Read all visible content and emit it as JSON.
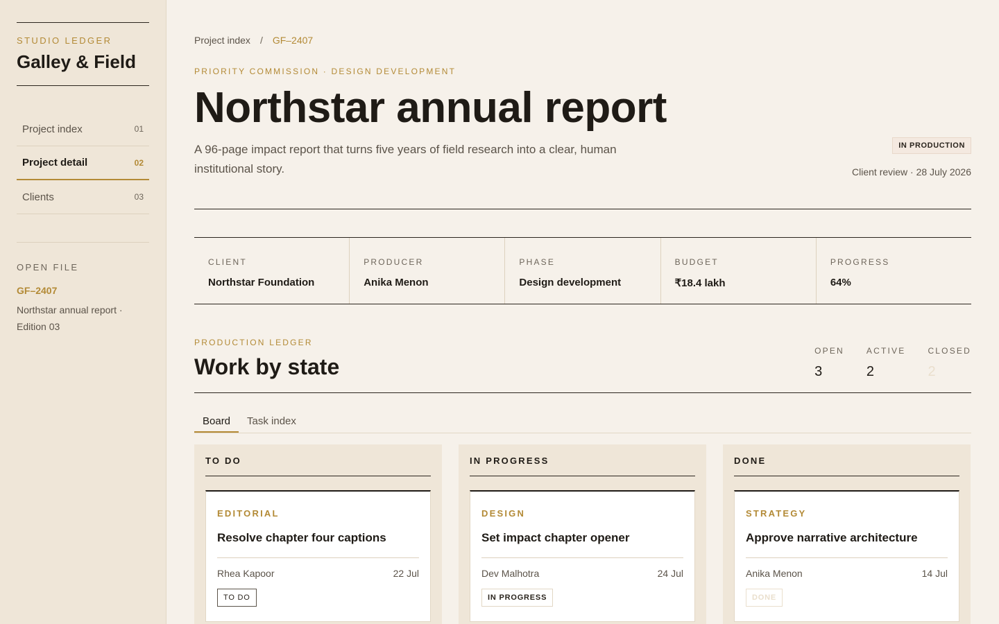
{
  "sidebar": {
    "brand_kicker": "STUDIO LEDGER",
    "brand_name": "Galley & Field",
    "nav": [
      {
        "label": "Project index",
        "num": "01"
      },
      {
        "label": "Project detail",
        "num": "02"
      },
      {
        "label": "Clients",
        "num": "03"
      }
    ],
    "open_file": {
      "kicker": "OPEN FILE",
      "id": "GF–2407",
      "desc": "Northstar annual report · Edition 03"
    }
  },
  "breadcrumb": {
    "parent": "Project index",
    "sep": "/",
    "current": "GF–2407"
  },
  "header": {
    "kicker": "PRIORITY COMMISSION · DESIGN DEVELOPMENT",
    "title": "Northstar annual report",
    "intro": "A 96-page impact report that turns five years of field research into a clear, human institutional story.",
    "status": "IN PRODUCTION",
    "review": "Client review · 28 July 2026"
  },
  "facts": [
    {
      "label": "CLIENT",
      "value": "Northstar Foundation"
    },
    {
      "label": "PRODUCER",
      "value": "Anika Menon"
    },
    {
      "label": "PHASE",
      "value": "Design development"
    },
    {
      "label": "BUDGET",
      "value": "₹18.4 lakh"
    },
    {
      "label": "PROGRESS",
      "value": "64%"
    }
  ],
  "ledger": {
    "kicker": "PRODUCTION LEDGER",
    "title": "Work by state",
    "counts": [
      {
        "label": "OPEN",
        "value": "3"
      },
      {
        "label": "ACTIVE",
        "value": "2"
      },
      {
        "label": "CLOSED",
        "value": "2"
      }
    ]
  },
  "tabs": [
    {
      "label": "Board"
    },
    {
      "label": "Task index"
    }
  ],
  "board": [
    {
      "title": "TO DO",
      "card": {
        "category": "EDITORIAL",
        "title": "Resolve chapter four captions",
        "assignee": "Rhea Kapoor",
        "date": "22 Jul",
        "status": "TO DO"
      }
    },
    {
      "title": "IN PROGRESS",
      "card": {
        "category": "DESIGN",
        "title": "Set impact chapter opener",
        "assignee": "Dev Malhotra",
        "date": "24 Jul",
        "status": "IN PROGRESS"
      }
    },
    {
      "title": "DONE",
      "card": {
        "category": "STRATEGY",
        "title": "Approve narrative architecture",
        "assignee": "Anika Menon",
        "date": "14 Jul",
        "status": "DONE"
      }
    }
  ],
  "colors": {
    "accent": "#b38a36",
    "ink": "#1f1b16",
    "paper": "#f6f1ea",
    "panel": "#efe6d8"
  }
}
